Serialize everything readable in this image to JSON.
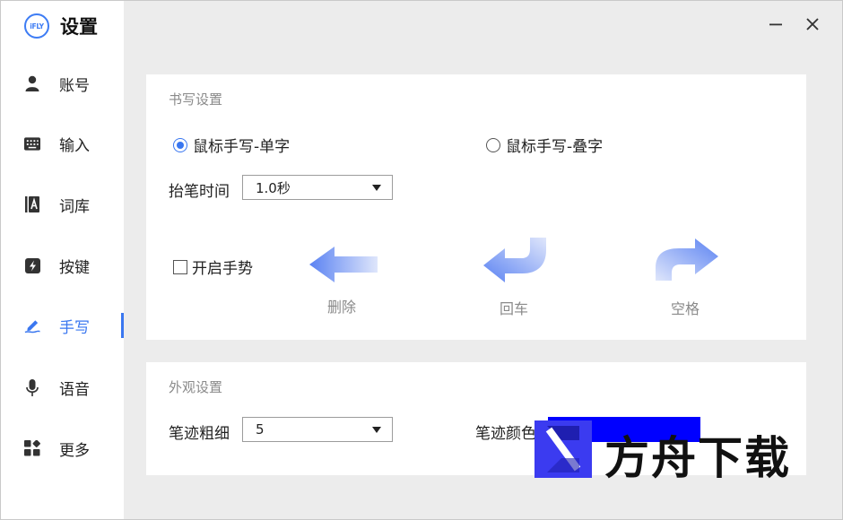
{
  "app": {
    "logo_text": "iFLY",
    "title": "设置"
  },
  "window_controls": {
    "minimize_icon": "minimize-icon",
    "close_icon": "close-icon"
  },
  "sidebar": {
    "active_index": 4,
    "accent_color": "#3a77f0",
    "items": [
      {
        "label": "账号",
        "icon": "user-icon"
      },
      {
        "label": "输入",
        "icon": "keyboard-icon"
      },
      {
        "label": "词库",
        "icon": "book-icon"
      },
      {
        "label": "按键",
        "icon": "lightning-key-icon"
      },
      {
        "label": "手写",
        "icon": "pen-icon"
      },
      {
        "label": "语音",
        "icon": "microphone-icon"
      },
      {
        "label": "更多",
        "icon": "grid-more-icon"
      }
    ]
  },
  "handwriting_settings": {
    "section_title": "书写设置",
    "mode_single": {
      "label": "鼠标手写-单字",
      "checked": true
    },
    "mode_overlap": {
      "label": "鼠标手写-叠字",
      "checked": false
    },
    "pen_lift_time": {
      "label": "抬笔时间",
      "value": "1.0秒"
    },
    "gesture_toggle": {
      "label": "开启手势",
      "checked": false
    },
    "gestures": [
      {
        "label": "删除",
        "icon": "arrow-left-icon"
      },
      {
        "label": "回车",
        "icon": "arrow-return-icon"
      },
      {
        "label": "空格",
        "icon": "arrow-turn-right-icon"
      }
    ]
  },
  "appearance_settings": {
    "section_title": "外观设置",
    "stroke_width": {
      "label": "笔迹粗细",
      "value": "5"
    },
    "stroke_color": {
      "label": "笔迹颜色",
      "value": "#0000ff"
    }
  },
  "watermark": {
    "text": "方舟下载"
  }
}
